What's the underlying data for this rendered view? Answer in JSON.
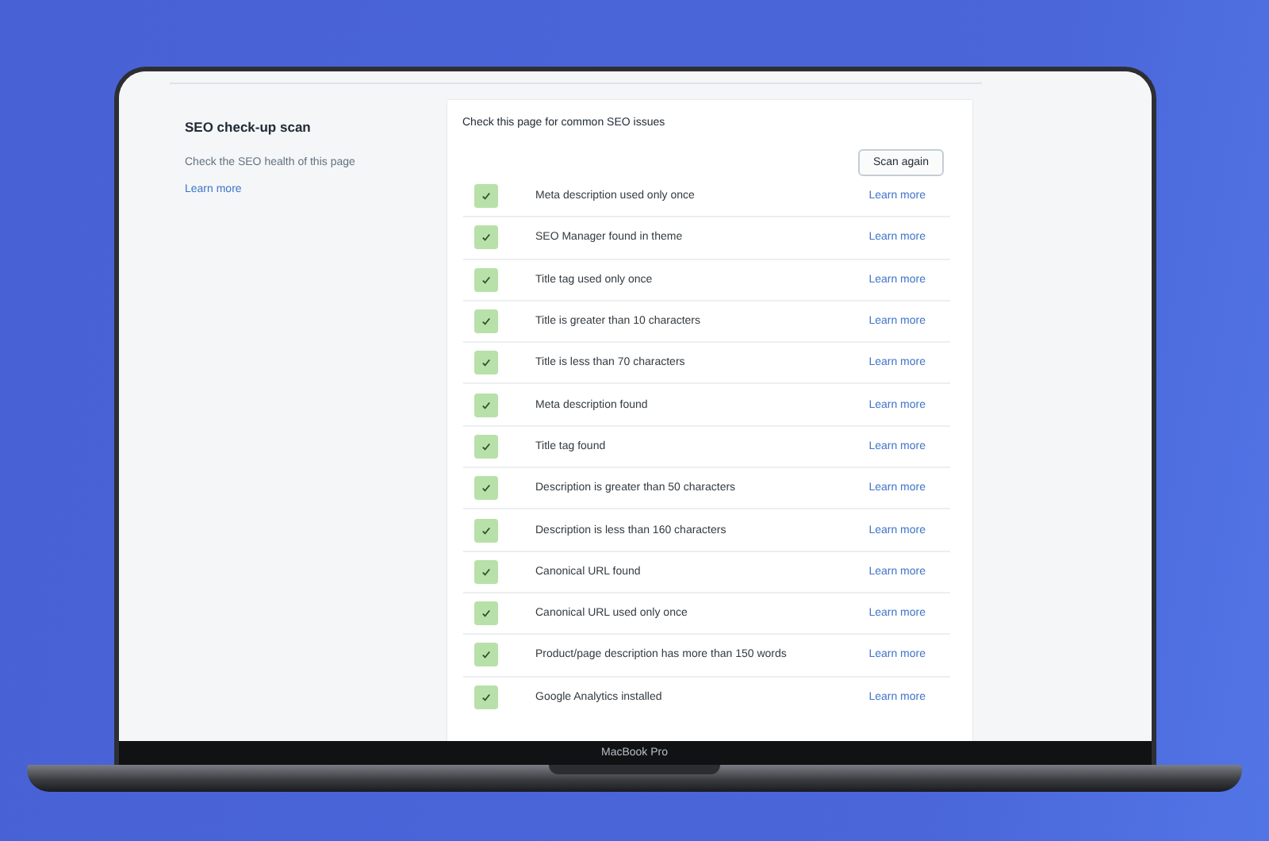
{
  "sidebar": {
    "title": "SEO check-up scan",
    "description": "Check the SEO health of this page",
    "link": "Learn more"
  },
  "card": {
    "heading": "Check this page for common SEO issues",
    "button": "Scan again",
    "checks": [
      {
        "label": "Meta description used only once",
        "passed": true,
        "link": "Learn more"
      },
      {
        "label": "SEO Manager found in theme",
        "passed": true,
        "link": "Learn more"
      },
      {
        "label": "Title tag used only once",
        "passed": true,
        "link": "Learn more"
      },
      {
        "label": "Title is greater than 10 characters",
        "passed": true,
        "link": "Learn more"
      },
      {
        "label": "Title is less than 70 characters",
        "passed": true,
        "link": "Learn more"
      },
      {
        "label": "Meta description found",
        "passed": true,
        "link": "Learn more"
      },
      {
        "label": "Title tag found",
        "passed": true,
        "link": "Learn more"
      },
      {
        "label": "Description is greater than 50 characters",
        "passed": true,
        "link": "Learn more"
      },
      {
        "label": "Description is less than 160 characters",
        "passed": true,
        "link": "Learn more"
      },
      {
        "label": "Canonical URL found",
        "passed": true,
        "link": "Learn more"
      },
      {
        "label": "Canonical URL used only once",
        "passed": true,
        "link": "Learn more"
      },
      {
        "label": "Product/page description has more than 150 words",
        "passed": true,
        "link": "Learn more"
      },
      {
        "label": "Google Analytics installed",
        "passed": true,
        "link": "Learn more"
      }
    ]
  },
  "device": {
    "label": "MacBook Pro"
  }
}
